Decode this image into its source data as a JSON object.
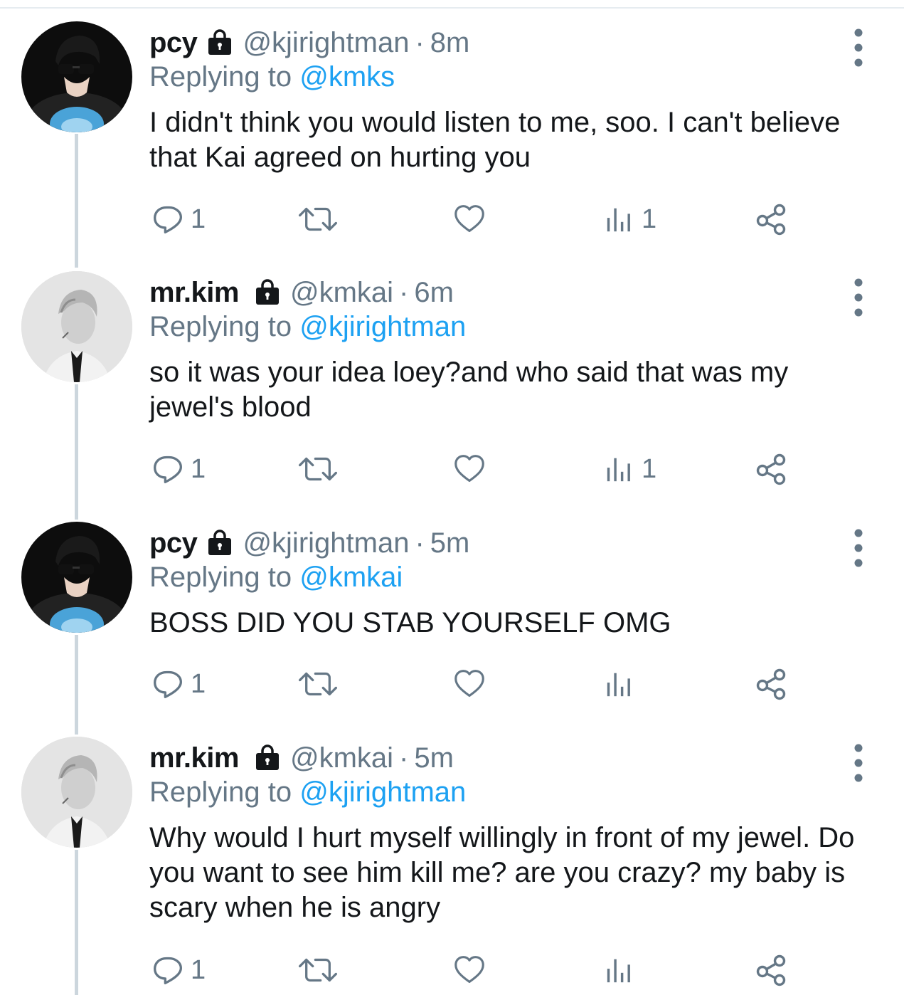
{
  "colors": {
    "accent": "#1da1f2",
    "secondary_text": "#657786",
    "primary_text": "#14171a",
    "thread_line": "#ccd6dd"
  },
  "tweets": [
    {
      "display_name": "pcy",
      "handle": "@kjirightman",
      "separator": "·",
      "time": "8m",
      "reply_prefix": "Replying to",
      "reply_to": "@kmks",
      "text": "I didn't think you would listen to me, soo. I can't believe that Kai agreed on hurting you",
      "icons": [
        "lock-icon",
        "more-icon",
        "reply-icon",
        "retweet-icon",
        "like-icon",
        "views-icon",
        "share-icon"
      ],
      "reply_count": "1",
      "view_count": "1"
    },
    {
      "display_name": "mr.kim",
      "handle": "@kmkai",
      "separator": "·",
      "time": "6m",
      "reply_prefix": "Replying to",
      "reply_to": "@kjirightman",
      "text": "so it was your idea loey?and who said that was my jewel's blood",
      "icons": [
        "lock-icon",
        "more-icon",
        "reply-icon",
        "retweet-icon",
        "like-icon",
        "views-icon",
        "share-icon"
      ],
      "reply_count": "1",
      "view_count": "1"
    },
    {
      "display_name": "pcy",
      "handle": "@kjirightman",
      "separator": "·",
      "time": "5m",
      "reply_prefix": "Replying to",
      "reply_to": "@kmkai",
      "text": "BOSS DID YOU STAB YOURSELF OMG",
      "icons": [
        "lock-icon",
        "more-icon",
        "reply-icon",
        "retweet-icon",
        "like-icon",
        "views-icon",
        "share-icon"
      ],
      "reply_count": "1",
      "view_count": ""
    },
    {
      "display_name": "mr.kim",
      "handle": "@kmkai",
      "separator": "·",
      "time": "5m",
      "reply_prefix": "Replying to",
      "reply_to": "@kjirightman",
      "text": "Why would I hurt myself willingly in front of my jewel. Do you want to see him kill me? are you crazy? my baby is scary when he is angry",
      "icons": [
        "lock-icon",
        "more-icon",
        "reply-icon",
        "retweet-icon",
        "like-icon",
        "views-icon",
        "share-icon"
      ],
      "reply_count": "1",
      "view_count": ""
    }
  ]
}
